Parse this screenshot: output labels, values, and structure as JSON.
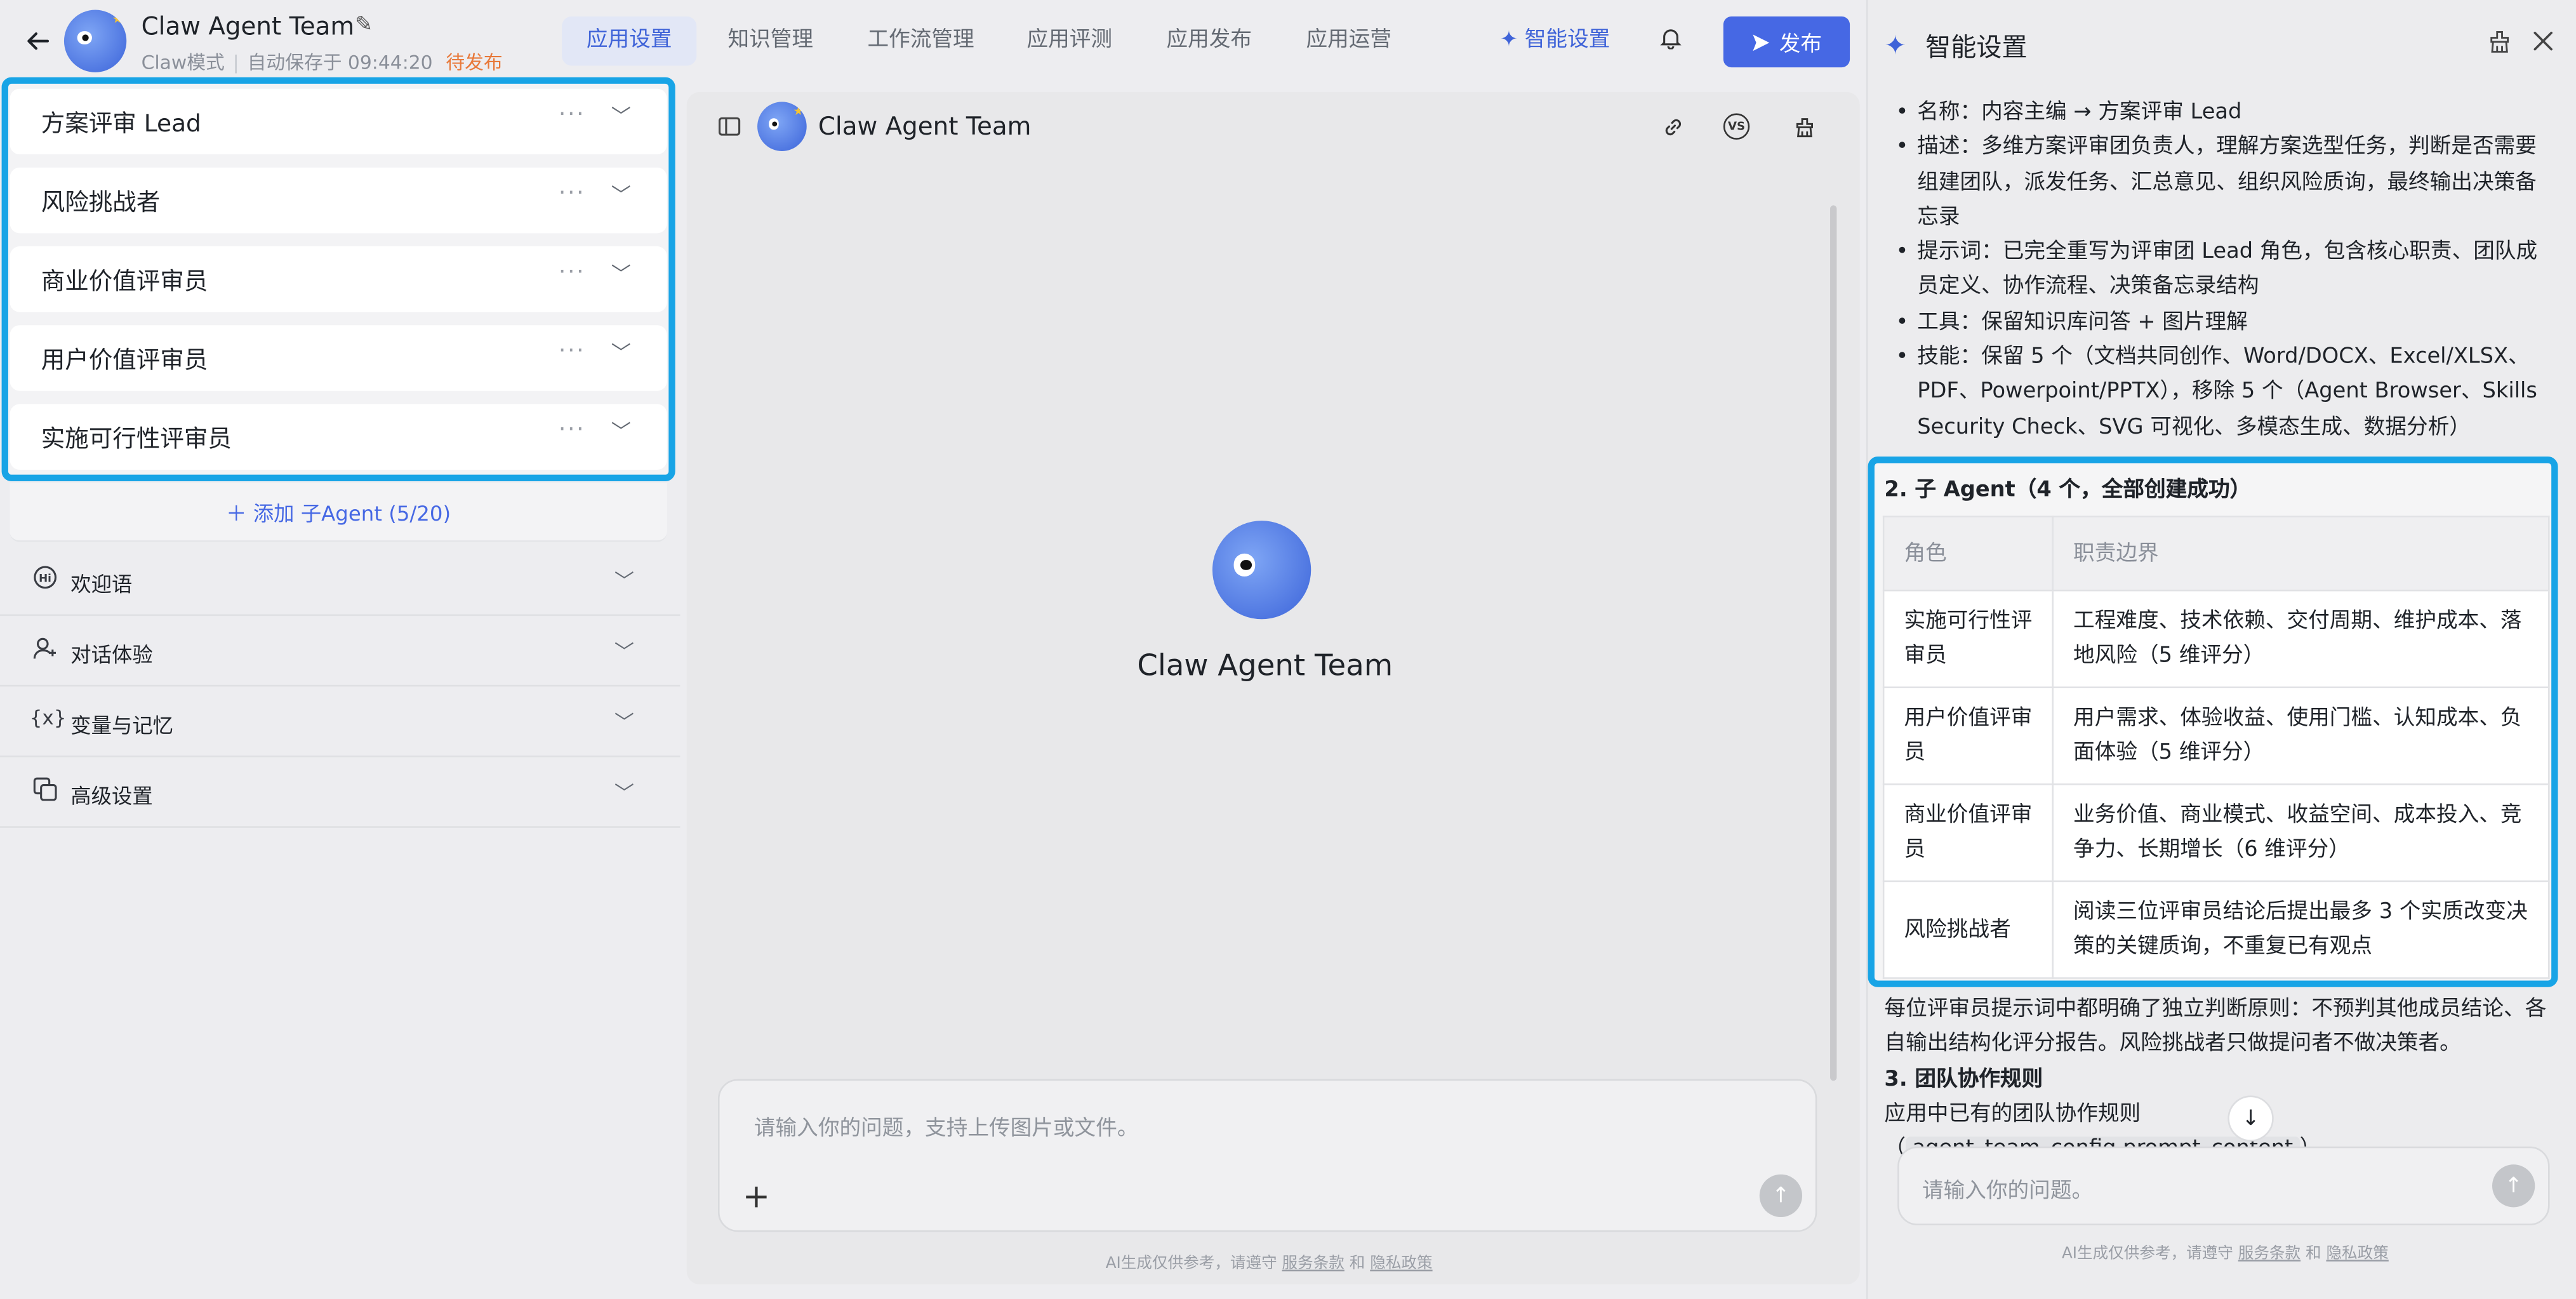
{
  "header": {
    "back_icon": "arrow-left-icon",
    "app_title": "Claw Agent Team",
    "mode": "Claw模式",
    "autosave": "自动保存于 09:44:20",
    "status": "待发布",
    "tabs": [
      {
        "label": "应用设置",
        "active": true
      },
      {
        "label": "知识管理",
        "active": false
      },
      {
        "label": "工作流管理",
        "active": false
      },
      {
        "label": "应用评测",
        "active": false
      },
      {
        "label": "应用发布",
        "active": false
      },
      {
        "label": "应用运营",
        "active": false
      }
    ],
    "smart_settings_label": "智能设置",
    "publish_label": "发布",
    "accent_color": "#4668e4"
  },
  "left": {
    "agents": [
      {
        "name": "方案评审 Lead"
      },
      {
        "name": "风险挑战者"
      },
      {
        "name": "商业价值评审员"
      },
      {
        "name": "用户价值评审员"
      },
      {
        "name": "实施可行性评审员"
      }
    ],
    "add_agent_label": "添加 子Agent (5/20)",
    "sections": [
      {
        "label": "欢迎语",
        "icon": "hi-icon"
      },
      {
        "label": "对话体验",
        "icon": "user-chat-icon"
      },
      {
        "label": "变量与记忆",
        "icon": "variable-icon"
      },
      {
        "label": "高级设置",
        "icon": "advanced-settings-icon"
      }
    ]
  },
  "center": {
    "title": "Claw Agent Team",
    "agent_name": "Claw Agent Team",
    "input_placeholder": "请输入你的问题，支持上传图片或文件。",
    "footer": {
      "prefix": "AI生成仅供参考，请遵守",
      "terms": "服务条款",
      "and": "和",
      "privacy": "隐私政策"
    }
  },
  "right": {
    "title": "智能设置",
    "bullets": [
      "名称：内容主编 → 方案评审 Lead",
      "描述：多维方案评审团负责人，理解方案选型任务，判断是否需要组建团队，派发任务、汇总意见、组织风险质询，最终输出决策备忘录",
      "提示词：已完全重写为评审团 Lead 角色，包含核心职责、团队成员定义、协作流程、决策备忘录结构",
      "工具：保留知识库问答 + 图片理解",
      "技能：保留 5 个（文档共同创作、Word/DOCX、Excel/XLSX、PDF、Powerpoint/PPTX），移除 5 个（Agent Browser、Skills Security Check、SVG 可视化、多模态生成、数据分析）"
    ],
    "table_heading": "2. 子 Agent（4 个，全部创建成功）",
    "table_headers": [
      "角色",
      "职责边界"
    ],
    "table_rows": [
      {
        "role": "实施可行性评审员",
        "duty": "工程难度、技术依赖、交付周期、维护成本、落地风险（5 维评分）"
      },
      {
        "role": "用户价值评审员",
        "duty": "用户需求、体验收益、使用门槛、认知成本、负面体验（5 维评分）"
      },
      {
        "role": "商业价值评审员",
        "duty": "业务价值、商业模式、收益空间、成本投入、竞争力、长期增长（6 维评分）"
      },
      {
        "role": "风险挑战者",
        "duty": "阅读三位评审员结论后提出最多 3 个实质改变决策的关键质询，不重复已有观点"
      }
    ],
    "after_text": "每位评审员提示词中都明确了独立判断原则：不预判其他成员结论、各自输出结构化评分报告。风险挑战者只做提问者不做决策者。",
    "section3_heading": "3. 团队协作规则",
    "section3_text": "应用中已有的团队协作规则（",
    "code_chip": "agent_team_config.prompt_content",
    "section3_end": "）",
    "input_placeholder": "请输入你的问题。",
    "footer": {
      "prefix": "AI生成仅供参考，请遵守",
      "terms": "服务条款",
      "and": "和",
      "privacy": "隐私政策"
    }
  }
}
